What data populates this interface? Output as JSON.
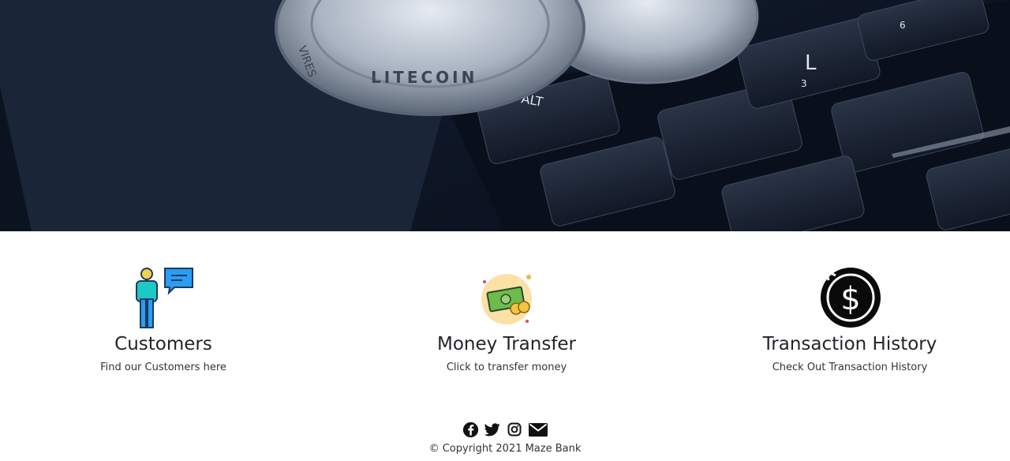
{
  "cards": [
    {
      "title": "Customers",
      "description": "Find our Customers here",
      "icon": "customer-chat-icon"
    },
    {
      "title": "Money Transfer",
      "description": "Click to transfer money",
      "icon": "money-transfer-icon"
    },
    {
      "title": "Transaction History",
      "description": "Check Out Transaction History",
      "icon": "dollar-history-icon"
    }
  ],
  "footer": {
    "social_icons": [
      "facebook-icon",
      "twitter-icon",
      "instagram-icon",
      "email-icon"
    ],
    "copyright": "© Copyright 2021 Maze Bank"
  },
  "hero": {
    "coin_texts": [
      "LITECOIN",
      "VIRES",
      "ALT"
    ],
    "keyboard_labels": [
      "L",
      "ALT",
      "3",
      "6"
    ]
  },
  "colors": {
    "background": "#ffffff",
    "hero_dark": "#0f1828",
    "text": "#212529"
  }
}
